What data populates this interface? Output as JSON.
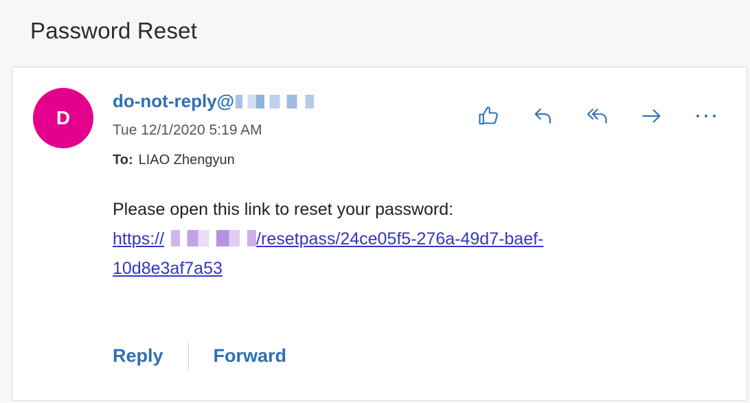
{
  "email": {
    "subject": "Password Reset",
    "avatar_initial": "D",
    "sender_prefix": "do-not-reply@",
    "date": "Tue 12/1/2020 5:19 AM",
    "to_label": "To:",
    "to_name": "LIAO Zhengyun",
    "body_line": "Please open this link to reset your password:",
    "link_prefix": "https://",
    "link_suffix_line1": "/resetpass/24ce05f5-276a-49d7-baef-",
    "link_line2": "10d8e3af7a53"
  },
  "footer": {
    "reply_label": "Reply",
    "forward_label": "Forward"
  },
  "icons": {
    "like": "thumbs-up-icon",
    "reply": "reply-icon",
    "reply_all": "reply-all-icon",
    "forward": "forward-arrow-icon",
    "more": "more-icon"
  },
  "colors": {
    "accent": "#2f6fb5",
    "avatar": "#e3008c",
    "link": "#3535c2"
  }
}
